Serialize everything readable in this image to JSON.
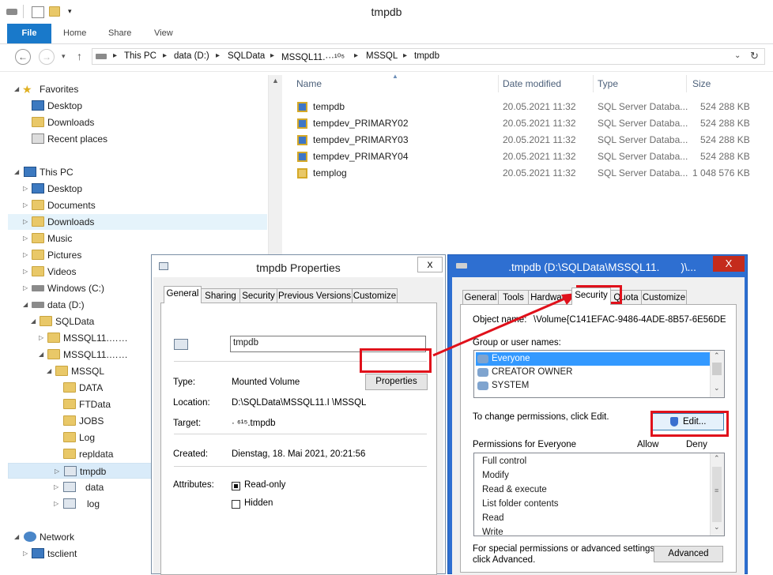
{
  "window": {
    "title": "tmpdb"
  },
  "ribbon": {
    "file": "File",
    "tabs": [
      "Home",
      "Share",
      "View"
    ]
  },
  "address": {
    "crumbs": [
      "This PC",
      "data (D:)",
      "SQLData",
      "MSSQL11.···¹⁰⁵",
      "MSSQL",
      "tmpdb"
    ]
  },
  "nav": {
    "favorites": "Favorites",
    "fav_items": [
      "Desktop",
      "Downloads",
      "Recent places"
    ],
    "thispc": "This PC",
    "pc_items": [
      "Desktop",
      "Documents",
      "Downloads",
      "Music",
      "Pictures",
      "Videos",
      "Windows (C:)",
      "data (D:)"
    ],
    "sqldata": "SQLData",
    "mssql_a": "MSSQL11.……",
    "mssql_b": "MSSQL11.……",
    "mssql": "MSSQL",
    "mssql_children": [
      "DATA",
      "FTData",
      "JOBS",
      "Log",
      "repldata",
      "tmpdb",
      "data",
      "log"
    ],
    "network": "Network",
    "tsclient": "tsclient"
  },
  "files": {
    "headers": {
      "name": "Name",
      "date": "Date modified",
      "type": "Type",
      "size": "Size"
    },
    "rows": [
      {
        "name": "tempdb",
        "date": "20.05.2021 11:32",
        "type": "SQL Server Databa...",
        "size": "524 288 KB"
      },
      {
        "name": "tempdev_PRIMARY02",
        "date": "20.05.2021 11:32",
        "type": "SQL Server Databa...",
        "size": "524 288 KB"
      },
      {
        "name": "tempdev_PRIMARY03",
        "date": "20.05.2021 11:32",
        "type": "SQL Server Databa...",
        "size": "524 288 KB"
      },
      {
        "name": "tempdev_PRIMARY04",
        "date": "20.05.2021 11:32",
        "type": "SQL Server Databa...",
        "size": "524 288 KB"
      },
      {
        "name": "templog",
        "date": "20.05.2021 11:32",
        "type": "SQL Server Databa...",
        "size": "1 048 576 KB"
      }
    ]
  },
  "props": {
    "title": "tmpdb Properties",
    "close": "x",
    "tabs": [
      "General",
      "Sharing",
      "Security",
      "Previous Versions",
      "Customize"
    ],
    "name_value": "tmpdb",
    "type_label": "Type:",
    "type_value": "Mounted Volume",
    "properties_button": "Properties",
    "location_label": "Location:",
    "location_value": "D:\\SQLData\\MSSQL11.I      \\MSSQL",
    "target_label": "Target:",
    "target_value": "· ⁶¹⁵.tmpdb",
    "created_label": "Created:",
    "created_value": "Dienstag, 18. Mai 2021, 20:21:56",
    "attributes_label": "Attributes:",
    "readonly": "Read-only",
    "hidden": "Hidden"
  },
  "sec": {
    "title": "    .tmpdb (D:\\SQLData\\MSSQL11.  )\\...",
    "close": "X",
    "tabs": [
      "General",
      "Tools",
      "Hardware",
      "Security",
      "Quota",
      "Customize"
    ],
    "object_label": "Object name:",
    "object_value": "\\Volume{C141EFAC-9486-4ADE-8B57-6E56DE",
    "group_label": "Group or user names:",
    "groups": [
      "Everyone",
      "CREATOR OWNER",
      "SYSTEM"
    ],
    "change_text": "To change permissions, click Edit.",
    "edit_button": "Edit...",
    "perm_for": "Permissions for Everyone",
    "allow": "Allow",
    "deny": "Deny",
    "perms": [
      "Full control",
      "Modify",
      "Read & execute",
      "List folder contents",
      "Read",
      "Write"
    ],
    "special_text_1": "For special permissions or advanced settings,",
    "special_text_2": "click Advanced.",
    "advanced_button": "Advanced"
  },
  "colors": {
    "accent": "#1979ca",
    "highlight": "#e0111b",
    "selection": "#3399ff"
  }
}
